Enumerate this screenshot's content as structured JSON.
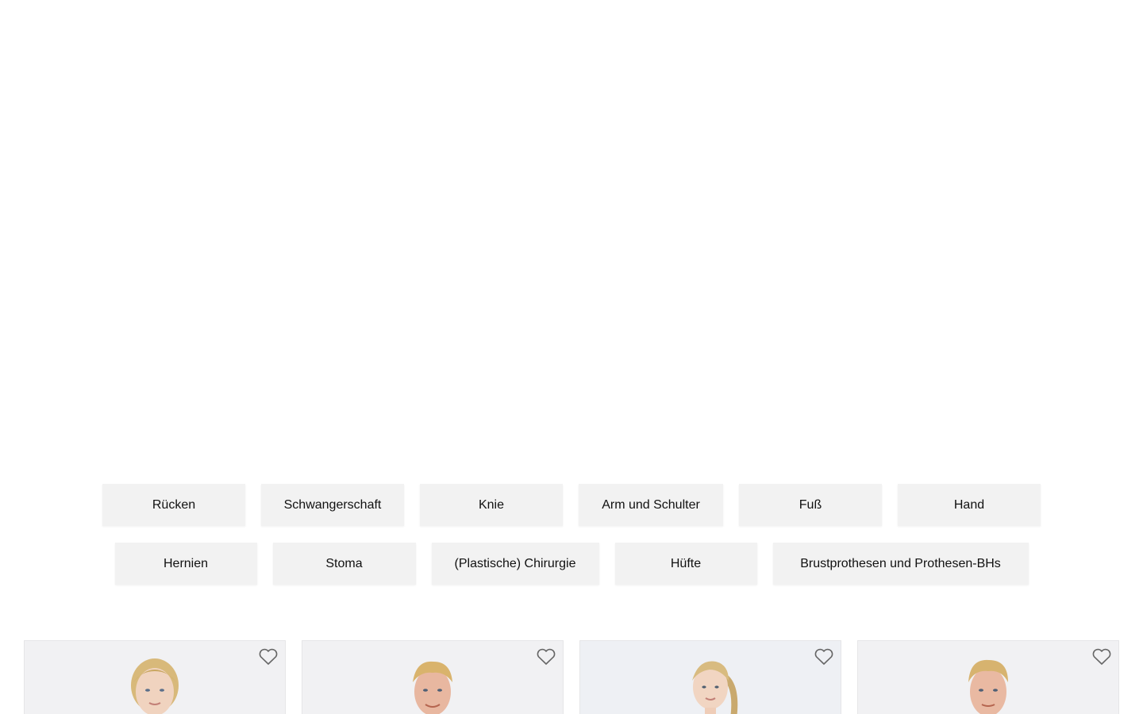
{
  "categories_row1": [
    {
      "label": "Rücken"
    },
    {
      "label": "Schwangerschaft"
    },
    {
      "label": "Knie"
    },
    {
      "label": "Arm und Schulter"
    },
    {
      "label": "Fuß"
    },
    {
      "label": "Hand"
    }
  ],
  "categories_row2": [
    {
      "label": "Hernien"
    },
    {
      "label": "Stoma"
    },
    {
      "label": "(Plastische) Chirurgie"
    },
    {
      "label": "Hüfte"
    },
    {
      "label": "Brustprothesen und Prothesen-BHs"
    }
  ],
  "products": [
    {
      "icon": "heart-outline-icon",
      "image": "woman-blonde-updo"
    },
    {
      "icon": "heart-outline-icon",
      "image": "man-blonde-short-hair"
    },
    {
      "icon": "heart-outline-icon",
      "image": "woman-blonde-ponytail"
    },
    {
      "icon": "heart-outline-icon",
      "image": "man-blonde-hair"
    }
  ],
  "colors": {
    "chip_bg": "#f2f2f2",
    "card_bg": "#f1f1f3",
    "text": "#111111",
    "heart_stroke": "#666666"
  }
}
